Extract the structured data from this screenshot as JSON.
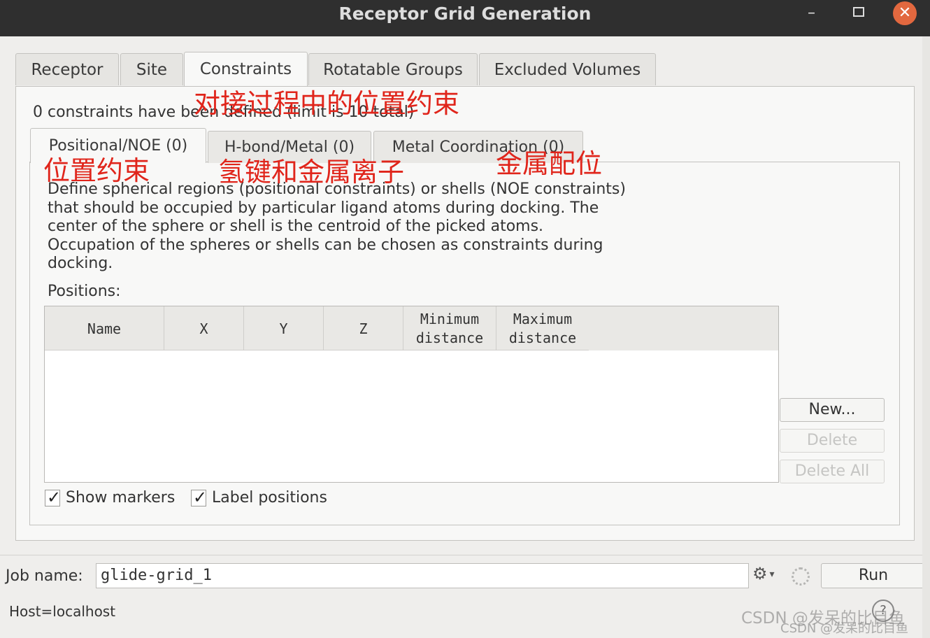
{
  "window": {
    "title": "Receptor Grid Generation",
    "minimize": "–",
    "close": "✕"
  },
  "main_tabs": [
    {
      "label": "Receptor"
    },
    {
      "label": "Site"
    },
    {
      "label": "Constraints"
    },
    {
      "label": "Rotatable Groups"
    },
    {
      "label": "Excluded Volumes"
    }
  ],
  "status_text": "0 constraints have been defined (limit is 10 total)",
  "sub_tabs": [
    {
      "label": "Positional/NOE (0)"
    },
    {
      "label": "H-bond/Metal (0)"
    },
    {
      "label": "Metal Coordination (0)"
    }
  ],
  "description": [
    "Define spherical regions (positional constraints) or shells (NOE constraints)",
    "that should be occupied by particular ligand atoms during docking.  The",
    "center of the sphere or shell is the centroid of the picked atoms.",
    "Occupation of the spheres or shells can be chosen as constraints during",
    "docking."
  ],
  "positions_label": "Positions:",
  "table": {
    "columns": [
      {
        "line1": "Name",
        "line2": ""
      },
      {
        "line1": "X",
        "line2": ""
      },
      {
        "line1": "Y",
        "line2": ""
      },
      {
        "line1": "Z",
        "line2": ""
      },
      {
        "line1": "Minimum",
        "line2": "distance"
      },
      {
        "line1": "Maximum",
        "line2": "distance"
      }
    ],
    "rows": []
  },
  "buttons": {
    "new": "New...",
    "delete": "Delete",
    "delete_all": "Delete All",
    "run": "Run"
  },
  "checkboxes": {
    "show_markers": {
      "label": "Show markers",
      "checked": true
    },
    "label_positions": {
      "label": "Label positions",
      "checked": true
    }
  },
  "job": {
    "label": "Job name:",
    "value": "glide-grid_1"
  },
  "host": "Host=localhost",
  "help": "?",
  "annotations": {
    "constraints": "对接过程中的位置约束",
    "positional": "位置约束",
    "hbond": "氢键和金属离子",
    "metal": "金属配位"
  },
  "watermark": {
    "line1": "CSDN @发呆的比目鱼",
    "line2": "CSDN @发呆的比目鱼"
  },
  "colors": {
    "annotation": "#e0251b",
    "close_button": "#e2683f",
    "titlebar": "#2f2f2f"
  }
}
